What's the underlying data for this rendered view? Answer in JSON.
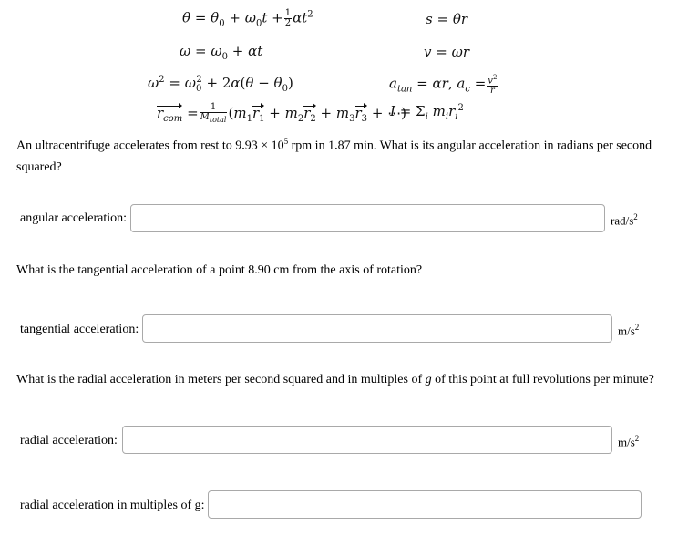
{
  "formulas": {
    "theta_eq": "θ = θ₀ + ω₀t + ½αt²",
    "omega_eq": "ω = ω₀ + αt",
    "omega_sq_eq": "ω² = ω₀² + 2α(θ − θ₀)",
    "arc_eq": "s = θr",
    "vel_eq": "v = ωr",
    "accel_eq": "a_tan = αr, a_c = v²/r",
    "com_eq": "r_com = (1/M_total)(m₁r₁ + m₂r₂ + m₃r₃ + ⋯)",
    "inertia_eq": "I = Σᵢ mᵢrᵢ²"
  },
  "questions": [
    {
      "text_before": "An ultracentrifuge accelerates from rest to 9.93 × 10",
      "exponent": "5",
      "text_after": " rpm in 1.87 min. What is its angular acceleration in radians per second squared?",
      "label": "angular acceleration:",
      "value": "",
      "unit": "rad/s",
      "unit_exp": "2"
    },
    {
      "text": "What is the tangential acceleration of a point 8.90 cm from the axis of rotation?",
      "label": "tangential acceleration:",
      "value": "",
      "unit": "m/s",
      "unit_exp": "2"
    },
    {
      "text_before": "What is the radial acceleration in meters per second squared and in multiples of ",
      "italic": "g",
      "text_after": " of this point at full revolutions per minute?",
      "label": "radial acceleration:",
      "value": "",
      "unit": "m/s",
      "unit_exp": "2"
    },
    {
      "label": "radial acceleration in multiples of g:",
      "value": ""
    }
  ]
}
